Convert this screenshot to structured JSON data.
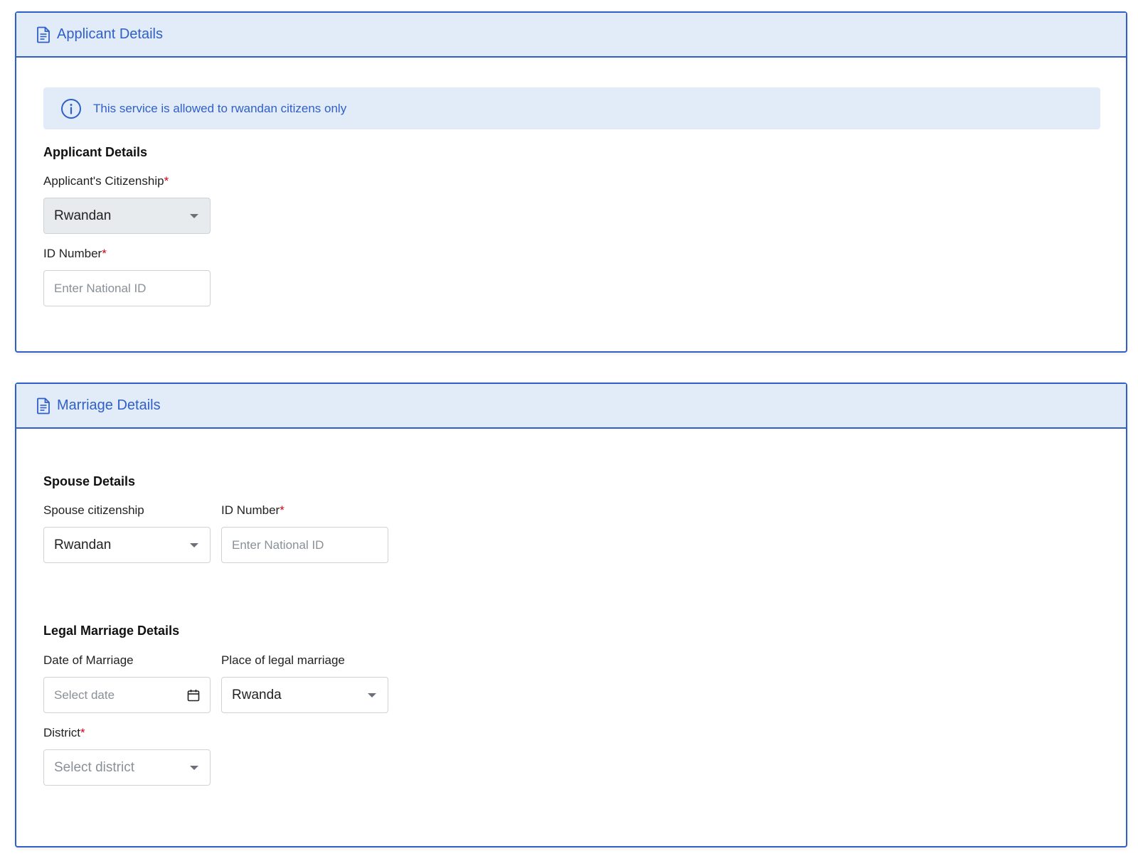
{
  "colors": {
    "accent": "#2f5fc7",
    "header_bg": "#e2ecf9",
    "required": "#d0021b",
    "disabled_bg": "#e8ebee"
  },
  "applicant_card": {
    "title": "Applicant Details",
    "icon": "document-icon",
    "alert": {
      "icon": "info-icon",
      "text": "This service is allowed to rwandan citizens only"
    },
    "section_heading": "Applicant Details",
    "citizenship": {
      "label": "Applicant's Citizenship",
      "required": "*",
      "value": "Rwandan",
      "disabled": true
    },
    "id_number": {
      "label": "ID Number",
      "required": "*",
      "value": "",
      "placeholder": "Enter National ID"
    }
  },
  "marriage_card": {
    "title": "Marriage Details",
    "icon": "document-icon",
    "spouse": {
      "section_heading": "Spouse Details",
      "citizenship": {
        "label": "Spouse citizenship",
        "value": "Rwandan"
      },
      "id_number": {
        "label": "ID Number",
        "required": "*",
        "value": "",
        "placeholder": "Enter National ID"
      }
    },
    "legal": {
      "section_heading": "Legal Marriage Details",
      "date": {
        "label": "Date of Marriage",
        "placeholder": "Select date",
        "icon": "calendar-icon"
      },
      "place": {
        "label": "Place of legal marriage",
        "value": "Rwanda"
      },
      "district": {
        "label": "District",
        "required": "*",
        "placeholder": "Select district"
      }
    }
  }
}
